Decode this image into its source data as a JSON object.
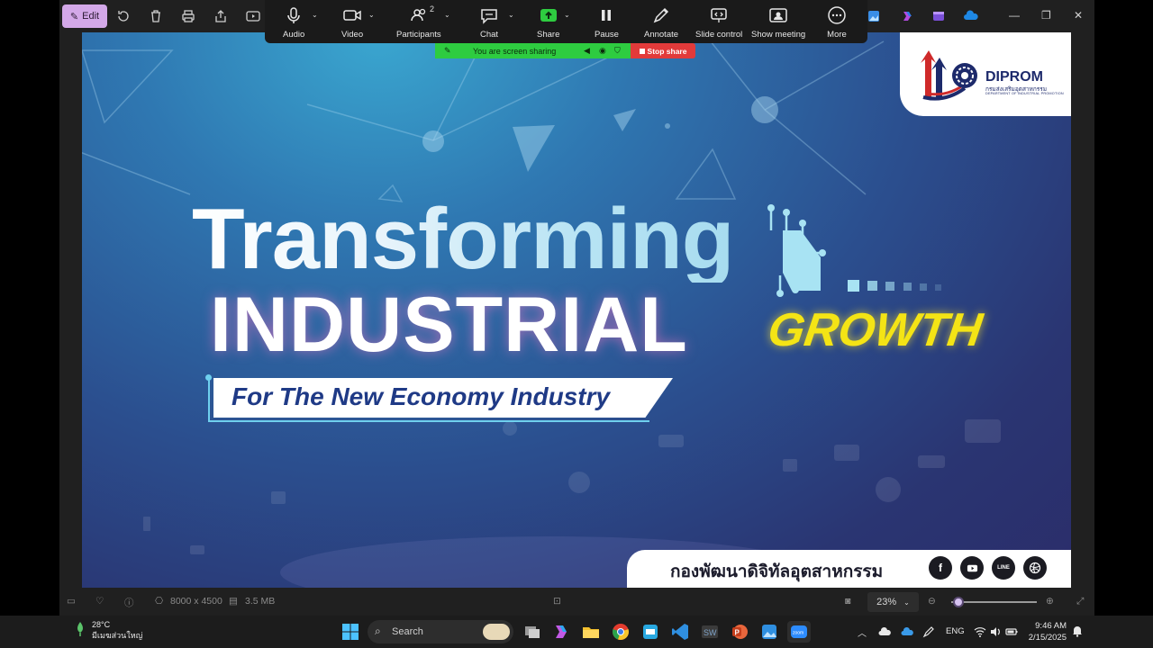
{
  "photos_toolbar": {
    "edit_label": "Edit"
  },
  "zoom_toolbar": {
    "participants_count": "2",
    "items": [
      {
        "label": "Audio"
      },
      {
        "label": "Video"
      },
      {
        "label": "Participants"
      },
      {
        "label": "Chat"
      },
      {
        "label": "Share"
      },
      {
        "label": "Pause"
      },
      {
        "label": "Annotate"
      },
      {
        "label": "Slide control"
      },
      {
        "label": "Show meeting"
      },
      {
        "label": "More"
      }
    ],
    "sharing_status": "You are screen sharing",
    "stop_share_label": "Stop share",
    "colors": {
      "share_bar": "#2ecc40",
      "stop_share": "#e23a3a"
    }
  },
  "slide": {
    "title_line1": "Transforming",
    "title_line2": "INDUSTRIAL",
    "title_accent": "GROWTH",
    "subtitle": "For The New Economy Industry",
    "logo_name": "DIPROM",
    "logo_thai": "กรมส่งเสริมอุตสาหกรรม",
    "logo_english": "DEPARTMENT OF INDUSTRIAL PROMOTION",
    "footer_thai": "กองพัฒนาดิจิทัลอุตสาหกรรม",
    "social_icons": [
      "facebook-icon",
      "youtube-icon",
      "line-icon",
      "website-icon"
    ],
    "colors": {
      "accent_yellow": "#f4e415",
      "subtitle_blue": "#1f3a86",
      "bg_blue": "#2b4f8f"
    }
  },
  "photos_bottom": {
    "dimensions": "8000 x 4500",
    "file_size": "3.5 MB",
    "zoom": "23%"
  },
  "taskbar": {
    "temperature": "28°C",
    "weather_text": "มีเมฆส่วนใหญ่",
    "search_placeholder": "Search",
    "language": "ENG",
    "time": "9:46 AM",
    "date": "2/15/2025"
  }
}
